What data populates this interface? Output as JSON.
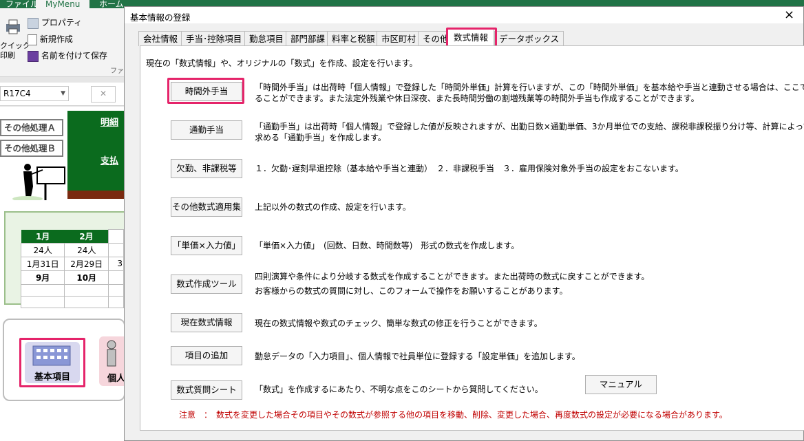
{
  "excel": {
    "ribbon_tabs": [
      "ファイル",
      "MyMenu",
      "ホーム"
    ],
    "quick_access": {
      "quick_print": "クイック\n印刷",
      "property": "プロパティ",
      "new": "新規作成",
      "save_as": "名前を付けて保存",
      "group_label": "ファ"
    },
    "name_box": "R17C4",
    "cancel_symbol": "✕",
    "sheet": {
      "buttons": [
        "その他処理Ａ",
        "その他処理Ｂ"
      ],
      "links": [
        "明細",
        "支払"
      ],
      "calendar": {
        "headers": [
          "1月",
          "2月"
        ],
        "rows": [
          [
            "24人",
            "24人"
          ],
          [
            "1月31日",
            "2月29日"
          ],
          [
            "9月",
            "10月"
          ]
        ],
        "extra_cell": "3"
      },
      "icon_buttons": [
        "基本項目",
        "個人"
      ]
    }
  },
  "dialog": {
    "title": "基本情報の登録",
    "close": "×",
    "tabs": [
      "会社情報",
      "手当･控除項目",
      "勤怠項目",
      "部門部課",
      "料率と税額",
      "市区町村",
      "その他",
      "数式情報",
      "データボックス"
    ],
    "intro": "現在の「数式情報」や、オリジナルの「数式」を作成、設定を行います。",
    "items": [
      {
        "label": "時間外手当",
        "desc": [
          "「時間外手当」は出荷時「個人情報」で登録した「時間外単価」計算を行いますが、この「時間外単価」を基本給や手当と連動させる場合は、ここで設定す",
          "ることができます。また法定外残業や休日深夜、また長時間労働の割増残業等の時間外手当も作成することができます。"
        ]
      },
      {
        "label": "通勤手当",
        "desc": [
          "「通勤手当」は出荷時「個人情報」で登録した値が反映されますが、出勤日数×通勤単価、3か月単位での支給、課税非課税振り分け等、計算によって",
          "求める「通勤手当」を作成します。"
        ]
      },
      {
        "label": "欠勤、非課税等",
        "desc": [
          "１．欠勤･遅刻早退控除（基本給や手当と連動）　２．非課税手当　３．雇用保険対象外手当の設定をおこないます。"
        ]
      },
      {
        "label": "その他数式適用集",
        "desc": [
          "上記以外の数式の作成、設定を行います。"
        ]
      },
      {
        "label": "「単価×入力値」",
        "desc": [
          "「単価×入力値」　(回数、日数、時間数等)　形式の数式を作成します。"
        ]
      },
      {
        "label": "数式作成ツール",
        "desc": [
          "四則演算や条件により分岐する数式を作成することができます。また出荷時の数式に戻すことができます。",
          "お客様からの数式の質問に対し、このフォームで操作をお願いすることがあります。"
        ]
      },
      {
        "label": "現在数式情報",
        "desc": [
          "現在の数式情報や数式のチェック、簡単な数式の修正を行うことができます。"
        ]
      },
      {
        "label": "項目の追加",
        "desc": [
          "勤怠データの「入力項目」、個人情報で社員単位に登録する「設定単価」を追加します。"
        ]
      },
      {
        "label": "数式質問シート",
        "desc": [
          "「数式」を作成するにあたり、不明な点をこのシートから質問してください。"
        ]
      }
    ],
    "manual_button": "マニュアル",
    "note": "注意　：　数式を変更した場合その項目やその数式が参照する他の項目を移動、削除、変更した場合、再度数式の設定が必要になる場合があります。"
  }
}
